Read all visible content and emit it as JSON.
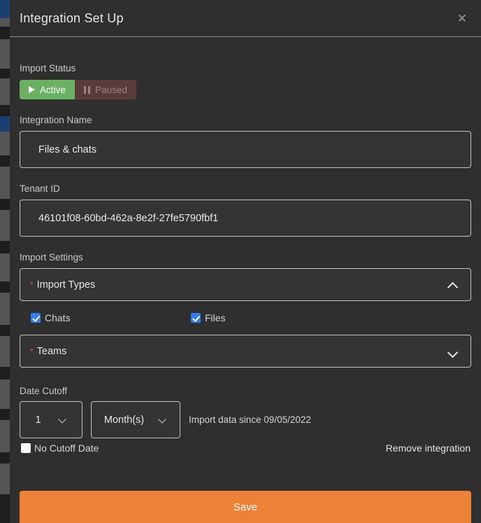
{
  "window": {
    "title": "Integration Set Up",
    "close_icon": "close-icon"
  },
  "import_status": {
    "label": "Import Status",
    "active_label": "Active",
    "paused_label": "Paused",
    "selected": "Active",
    "active_color": "#6cb063",
    "paused_color": "#5c3a39"
  },
  "integration_name": {
    "label": "Integration Name",
    "value": "Files & chats",
    "placeholder": "Integration Name"
  },
  "tenant_id": {
    "label": "Tenant ID",
    "value": "46101f08-60bd-462a-8e2f-27fe5790fbf1",
    "placeholder": "Tenant ID"
  },
  "import_settings": {
    "label": "Import Settings",
    "import_types": {
      "label": "Import Types",
      "required_marker": "*",
      "expanded": true,
      "chevron_icon": "chevron-up-icon",
      "options": [
        {
          "label": "Chats",
          "checked": true
        },
        {
          "label": "Files",
          "checked": true
        }
      ]
    },
    "teams": {
      "label": "Teams",
      "required_marker": "*",
      "expanded": false,
      "chevron_icon": "chevron-down-icon"
    }
  },
  "date_cutoff": {
    "label": "Date Cutoff",
    "amount_value": "1",
    "unit_value": "Month(s)",
    "since_note": "Import data since 09/05/2022",
    "no_cutoff_label": "No Cutoff Date",
    "no_cutoff_checked": false
  },
  "actions": {
    "remove_label": "Remove integration",
    "save_label": "Save",
    "save_color": "#ed8136"
  },
  "theme": {
    "modal_bg": "#2f2f2f",
    "field_bg": "#343434",
    "border": "#c3c3c3",
    "required_red": "#d9534f",
    "checkbox_blue": "#2f7def"
  }
}
